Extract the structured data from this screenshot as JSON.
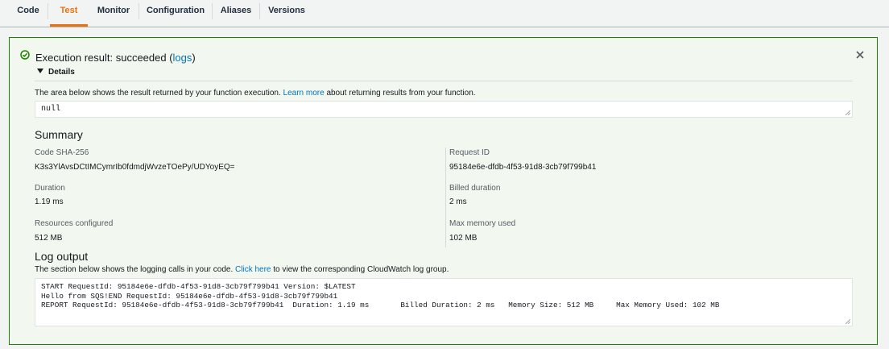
{
  "tabs": [
    {
      "label": "Code",
      "active": false
    },
    {
      "label": "Test",
      "active": true
    },
    {
      "label": "Monitor",
      "active": false
    },
    {
      "label": "Configuration",
      "active": false
    },
    {
      "label": "Aliases",
      "active": false
    },
    {
      "label": "Versions",
      "active": false
    }
  ],
  "result": {
    "title_prefix": "Execution result: succeeded (",
    "logs_link": "logs",
    "title_suffix": ")",
    "details_label": "Details",
    "desc_prefix": "The area below shows the result returned by your function execution.",
    "learn_more": "Learn more",
    "desc_suffix": "about returning results from your function.",
    "output": "null"
  },
  "summary": {
    "title": "Summary",
    "code_sha_label": "Code SHA-256",
    "code_sha_value": "K3s3YlAvsDCtIMCymrIb0fdmdjWvzeTOePy/UDYoyEQ=",
    "request_id_label": "Request ID",
    "request_id_value": "95184e6e-dfdb-4f53-91d8-3cb79f799b41",
    "duration_label": "Duration",
    "duration_value": "1.19 ms",
    "billed_label": "Billed duration",
    "billed_value": "2 ms",
    "resources_label": "Resources configured",
    "resources_value": "512 MB",
    "maxmem_label": "Max memory used",
    "maxmem_value": "102 MB"
  },
  "log": {
    "title": "Log output",
    "desc_prefix": "The section below shows the logging calls in your code.",
    "click_here": "Click here",
    "desc_suffix": "to view the corresponding CloudWatch log group.",
    "text": "START RequestId: 95184e6e-dfdb-4f53-91d8-3cb79f799b41 Version: $LATEST\nHello from SQS!END RequestId: 95184e6e-dfdb-4f53-91d8-3cb79f799b41\nREPORT RequestId: 95184e6e-dfdb-4f53-91d8-3cb79f799b41  Duration: 1.19 ms       Billed Duration: 2 ms   Memory Size: 512 MB     Max Memory Used: 102 MB"
  },
  "icons": {
    "success": "check-circle-icon",
    "close": "close-icon",
    "caret": "caret-down-icon"
  },
  "colors": {
    "accent": "#ec7211",
    "success": "#1d8102",
    "link": "#0073bb"
  }
}
